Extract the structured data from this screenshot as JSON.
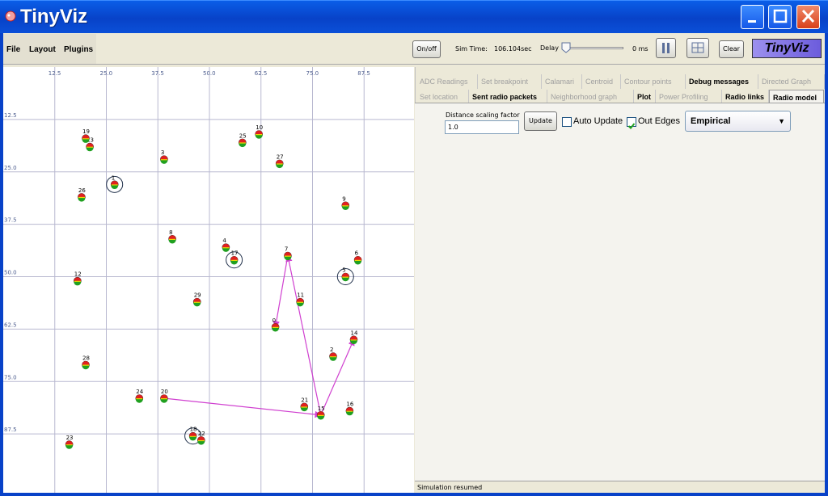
{
  "window": {
    "title": "TinyViz"
  },
  "menu": {
    "items": [
      "File",
      "Layout",
      "Plugins"
    ]
  },
  "toolbar": {
    "onoff_label": "On/off",
    "sim_time_label": "Sim Time:",
    "sim_time_value": "106.104sec",
    "delay_label": "Delay",
    "delay_value": "0 ms",
    "clear_label": "Clear",
    "logo_text": "TinyViz"
  },
  "tabs_row1": [
    {
      "label": "ADC Readings",
      "enabled": false
    },
    {
      "label": "Set breakpoint",
      "enabled": false
    },
    {
      "label": "Calamari",
      "enabled": false
    },
    {
      "label": "Centroid",
      "enabled": false
    },
    {
      "label": "Contour points",
      "enabled": false
    },
    {
      "label": "Debug messages",
      "enabled": true
    },
    {
      "label": "Directed Graph",
      "enabled": false
    }
  ],
  "tabs_row2": [
    {
      "label": "Set location",
      "enabled": false
    },
    {
      "label": "Sent radio packets",
      "enabled": true
    },
    {
      "label": "Neighborhood graph",
      "enabled": false
    },
    {
      "label": "Plot",
      "enabled": true
    },
    {
      "label": "Power Profiling",
      "enabled": false
    },
    {
      "label": "Radio links",
      "enabled": true
    },
    {
      "label": "Radio model",
      "enabled": true,
      "active": true
    }
  ],
  "radio_model": {
    "distance_label": "Distance scaling factor",
    "distance_value": "1.0",
    "update_label": "Update",
    "auto_update_label": "Auto Update",
    "auto_update_checked": false,
    "out_edges_label": "Out Edges",
    "out_edges_checked": true,
    "model_selected": "Empirical"
  },
  "status": {
    "text": "Simulation resumed"
  },
  "plot": {
    "x_ticks": [
      "12.5",
      "25.0",
      "37.5",
      "50.0",
      "62.5",
      "75.0",
      "87.5"
    ],
    "y_ticks": [
      "12.5",
      "25.0",
      "37.5",
      "50.0",
      "62.5",
      "75.0",
      "87.5"
    ],
    "motes": [
      {
        "id": "0",
        "x": 66,
        "y": 62,
        "circled": false
      },
      {
        "id": "1",
        "x": 27,
        "y": 28,
        "circled": true
      },
      {
        "id": "2",
        "x": 80,
        "y": 69,
        "circled": false
      },
      {
        "id": "3",
        "x": 39,
        "y": 22,
        "circled": false
      },
      {
        "id": "4",
        "x": 54,
        "y": 43,
        "circled": false
      },
      {
        "id": "5",
        "x": 83,
        "y": 50,
        "circled": true
      },
      {
        "id": "6",
        "x": 86,
        "y": 46,
        "circled": false
      },
      {
        "id": "7",
        "x": 69,
        "y": 45,
        "circled": false
      },
      {
        "id": "8",
        "x": 41,
        "y": 41,
        "circled": false
      },
      {
        "id": "9",
        "x": 83,
        "y": 33,
        "circled": false
      },
      {
        "id": "10",
        "x": 62,
        "y": 16,
        "circled": false
      },
      {
        "id": "11",
        "x": 72,
        "y": 56,
        "circled": false
      },
      {
        "id": "12",
        "x": 18,
        "y": 51,
        "circled": false
      },
      {
        "id": "13",
        "x": 21,
        "y": 19,
        "circled": false
      },
      {
        "id": "14",
        "x": 85,
        "y": 65,
        "circled": false
      },
      {
        "id": "15",
        "x": 77,
        "y": 83,
        "circled": false
      },
      {
        "id": "16",
        "x": 84,
        "y": 82,
        "circled": false
      },
      {
        "id": "17",
        "x": 56,
        "y": 46,
        "circled": true
      },
      {
        "id": "18",
        "x": 46,
        "y": 88,
        "circled": true
      },
      {
        "id": "19",
        "x": 20,
        "y": 17,
        "circled": false
      },
      {
        "id": "20",
        "x": 39,
        "y": 79,
        "circled": false
      },
      {
        "id": "21",
        "x": 73,
        "y": 81,
        "circled": false
      },
      {
        "id": "22",
        "x": 48,
        "y": 89,
        "circled": false
      },
      {
        "id": "23",
        "x": 16,
        "y": 90,
        "circled": false
      },
      {
        "id": "24",
        "x": 33,
        "y": 79,
        "circled": false
      },
      {
        "id": "25",
        "x": 58,
        "y": 18,
        "circled": false
      },
      {
        "id": "26",
        "x": 19,
        "y": 31,
        "circled": false
      },
      {
        "id": "27",
        "x": 67,
        "y": 23,
        "circled": false
      },
      {
        "id": "28",
        "x": 20,
        "y": 71,
        "circled": false
      },
      {
        "id": "29",
        "x": 47,
        "y": 56,
        "circled": false
      }
    ],
    "links": [
      {
        "from": "20",
        "to": "15"
      },
      {
        "from": "15",
        "to": "7"
      },
      {
        "from": "7",
        "to": "0"
      },
      {
        "from": "15",
        "to": "14"
      }
    ],
    "colors": {
      "grid": "#b8b8d0",
      "link": "#d040d0",
      "tick": "#506090",
      "mote_red": "#e02020",
      "mote_yellow": "#e8d800",
      "mote_green": "#20a020"
    }
  }
}
